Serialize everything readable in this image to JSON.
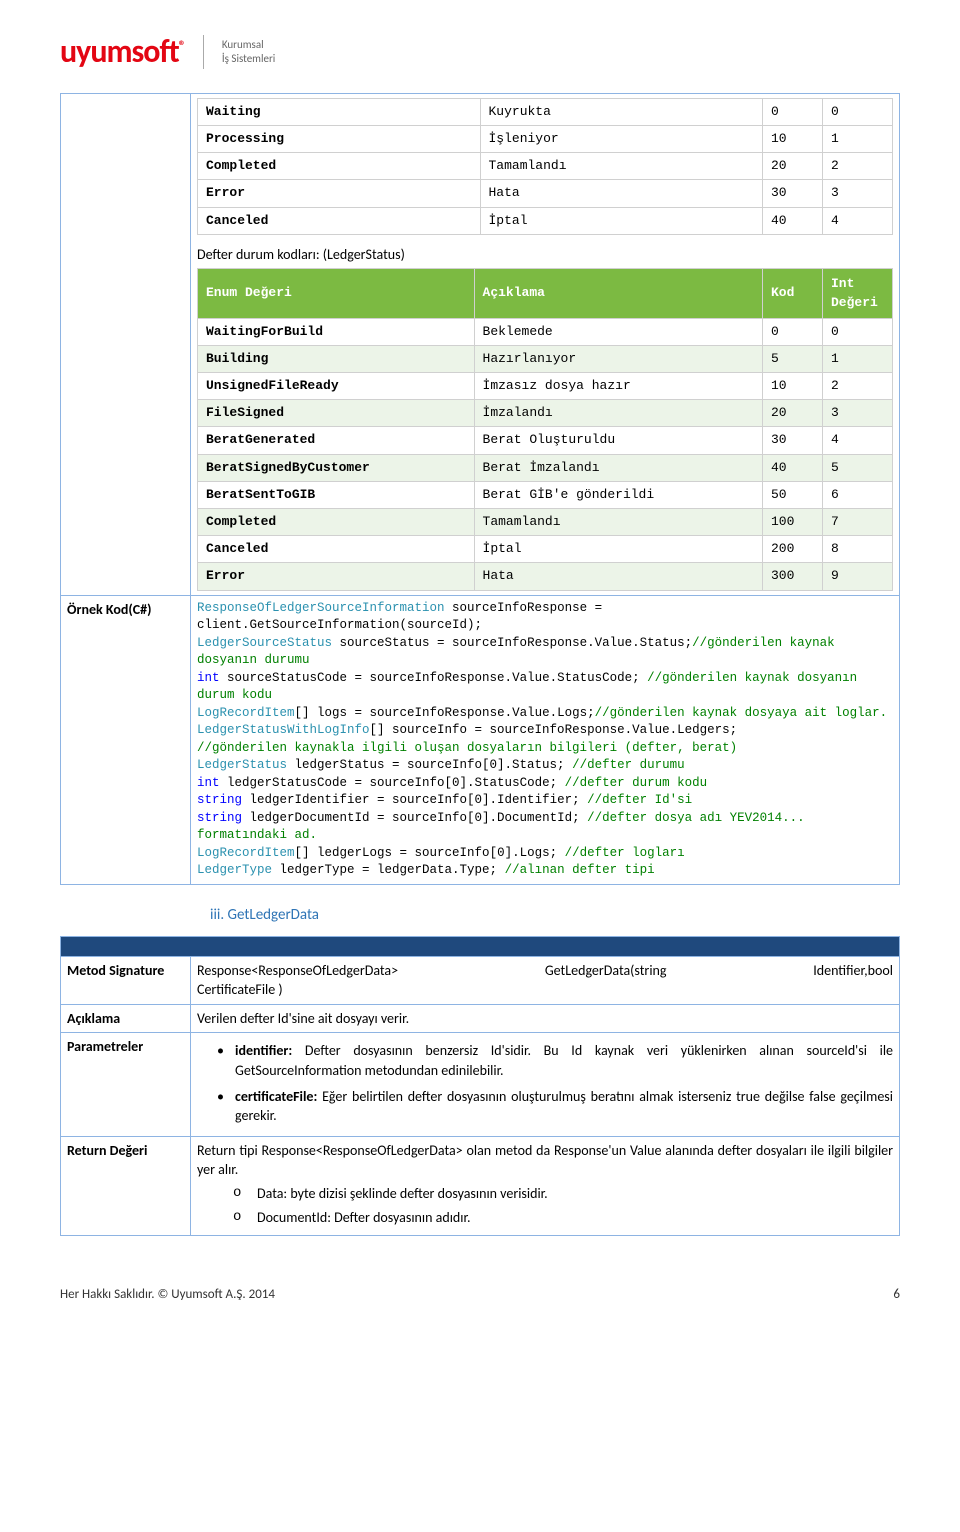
{
  "logo": {
    "name": "uyumsoft",
    "reg": "®",
    "sub1": "Kurumsal",
    "sub2": "İş Sistemleri"
  },
  "table1_cols": [
    "",
    "",
    "",
    ""
  ],
  "table1": [
    {
      "c0": "Waiting",
      "c1": "Kuyrukta",
      "c2": "0",
      "c3": "0"
    },
    {
      "c0": "Processing",
      "c1": "İşleniyor",
      "c2": "10",
      "c3": "1"
    },
    {
      "c0": "Completed",
      "c1": "Tamamlandı",
      "c2": "20",
      "c3": "2"
    },
    {
      "c0": "Error",
      "c1": "Hata",
      "c2": "30",
      "c3": "3"
    },
    {
      "c0": "Canceled",
      "c1": "İptal",
      "c2": "40",
      "c3": "4"
    }
  ],
  "table2_caption": "Defter durum kodları: (LedgerStatus)",
  "table2_header": {
    "h0": "Enum Değeri",
    "h1": "Açıklama",
    "h2": "Kod",
    "h3": "Int Değeri"
  },
  "table2": [
    {
      "c0": "WaitingForBuild",
      "c1": "Beklemede",
      "c2": "0",
      "c3": "0"
    },
    {
      "c0": "Building",
      "c1": "Hazırlanıyor",
      "c2": "5",
      "c3": "1"
    },
    {
      "c0": "UnsignedFileReady",
      "c1": "İmzasız dosya hazır",
      "c2": "10",
      "c3": "2"
    },
    {
      "c0": "FileSigned",
      "c1": "İmzalandı",
      "c2": "20",
      "c3": "3"
    },
    {
      "c0": "BeratGenerated",
      "c1": "Berat Oluşturuldu",
      "c2": "30",
      "c3": "4"
    },
    {
      "c0": "BeratSignedByCustomer",
      "c1": "Berat İmzalandı",
      "c2": "40",
      "c3": "5"
    },
    {
      "c0": "BeratSentToGIB",
      "c1": "Berat GİB'e gönderildi",
      "c2": "50",
      "c3": "6"
    },
    {
      "c0": "Completed",
      "c1": "Tamamlandı",
      "c2": "100",
      "c3": "7"
    },
    {
      "c0": "Canceled",
      "c1": "İptal",
      "c2": "200",
      "c3": "8"
    },
    {
      "c0": "Error",
      "c1": "Hata",
      "c2": "300",
      "c3": "9"
    }
  ],
  "example_label": "Örnek Kod(C#)",
  "code": {
    "l1a": "ResponseOfLedgerSourceInformation",
    "l1b": " sourceInfoResponse = client.GetSourceInformation(sourceId);",
    "l2a": "LedgerSourceStatus",
    "l2b": " sourceStatus = sourceInfoResponse.Value.Status;",
    "l2c": "//gönderilen kaynak dosyanın durumu",
    "l3a": "int",
    "l3b": " sourceStatusCode = sourceInfoResponse.Value.StatusCode; ",
    "l3c": "//gönderilen kaynak dosyanın durum kodu",
    "l4a": "LogRecordItem",
    "l4b": "[] logs = sourceInfoResponse.Value.Logs;",
    "l4c": "//gönderilen kaynak dosyaya ait loglar.",
    "l5a": "LedgerStatusWithLogInfo",
    "l5b": "[] sourceInfo = sourceInfoResponse.Value.Ledgers;",
    "l5c": "//gönderilen kaynakla ilgili oluşan dosyaların bilgileri (defter, berat)",
    "l6a": "LedgerStatus",
    "l6b": " ledgerStatus = sourceInfo[0].Status; ",
    "l6c": "//defter durumu",
    "l7a": "int",
    "l7b": " ledgerStatusCode = sourceInfo[0].StatusCode; ",
    "l7c": "//defter durum kodu",
    "l8a": "string",
    "l8b": " ledgerIdentifier = sourceInfo[0].Identifier; ",
    "l8c": "//defter Id'si",
    "l9a": "string",
    "l9b": " ledgerDocumentId = sourceInfo[0].DocumentId; ",
    "l9c": "//defter dosya adı YEV2014... formatındaki ad.",
    "l10a": "LogRecordItem",
    "l10b": "[] ledgerLogs = sourceInfo[0].Logs; ",
    "l10c": "//defter logları",
    "l11a": "LedgerType",
    "l11b": " ledgerType = ledgerData.Type; ",
    "l11c": "//alınan defter tipi"
  },
  "section": {
    "num": "iii.",
    "title": "GetLedgerData"
  },
  "metatable": {
    "r1": {
      "label": "Metod Signature",
      "v1": "Response<ResponseOfLedgerData>",
      "v2": "GetLedgerData(string",
      "v3": "Identifier,bool",
      "v4": "CertificateFile )"
    },
    "r2": {
      "label": "Açıklama",
      "value": "Verilen defter Id'sine ait dosyayı verir."
    },
    "r3": {
      "label": "Parametreler",
      "b1a": "identifier:",
      "b1b": " Defter dosyasının benzersiz Id'sidir. Bu Id kaynak veri yüklenirken alınan sourceId'si ile GetSourceInformation metodundan edinilebilir.",
      "b2a": "certificateFile:",
      "b2b": " Eğer belirtilen defter dosyasının oluşturulmuş beratını almak isterseniz true değilse false geçilmesi gerekir."
    },
    "r4": {
      "label": "Return Değeri",
      "p1": "Return tipi Response<ResponseOfLedgerData> olan metod da Response'un Value alanında defter dosyaları ile ilgili bilgiler  yer alır.",
      "c1": "Data: byte dizisi şeklinde defter dosyasının verisidir.",
      "c2": "DocumentId: Defter dosyasının adıdır."
    }
  },
  "footer": {
    "left": "Her Hakkı Saklıdır. © Uyumsoft A.Ş. 2014",
    "right": "6"
  }
}
